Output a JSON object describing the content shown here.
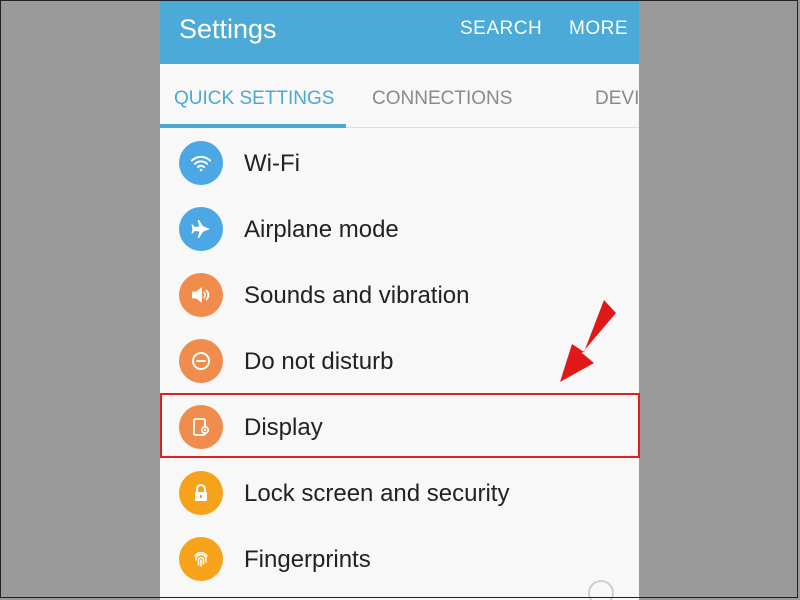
{
  "appbar": {
    "title": "Settings",
    "search_label": "SEARCH",
    "more_label": "MORE"
  },
  "tabs": [
    {
      "label": "QUICK SETTINGS",
      "active": true
    },
    {
      "label": "CONNECTIONS",
      "active": false
    },
    {
      "label": "DEVI",
      "active": false
    }
  ],
  "items": [
    {
      "label": "Wi-Fi",
      "icon": "wifi-icon",
      "color": "#4ba8e4"
    },
    {
      "label": "Airplane mode",
      "icon": "airplane-icon",
      "color": "#4ba8e4"
    },
    {
      "label": "Sounds and vibration",
      "icon": "speaker-icon",
      "color": "#f08c4c"
    },
    {
      "label": "Do not disturb",
      "icon": "do-not-disturb-icon",
      "color": "#f08c4c"
    },
    {
      "label": "Display",
      "icon": "display-icon",
      "color": "#f08c4c",
      "highlighted": true
    },
    {
      "label": "Lock screen and security",
      "icon": "lock-icon",
      "color": "#f7a21b"
    },
    {
      "label": "Fingerprints",
      "icon": "fingerprint-icon",
      "color": "#f7a21b"
    }
  ],
  "colors": {
    "appbar": "#4baad8",
    "accent": "#4ba8d6",
    "highlight": "#e02020"
  }
}
